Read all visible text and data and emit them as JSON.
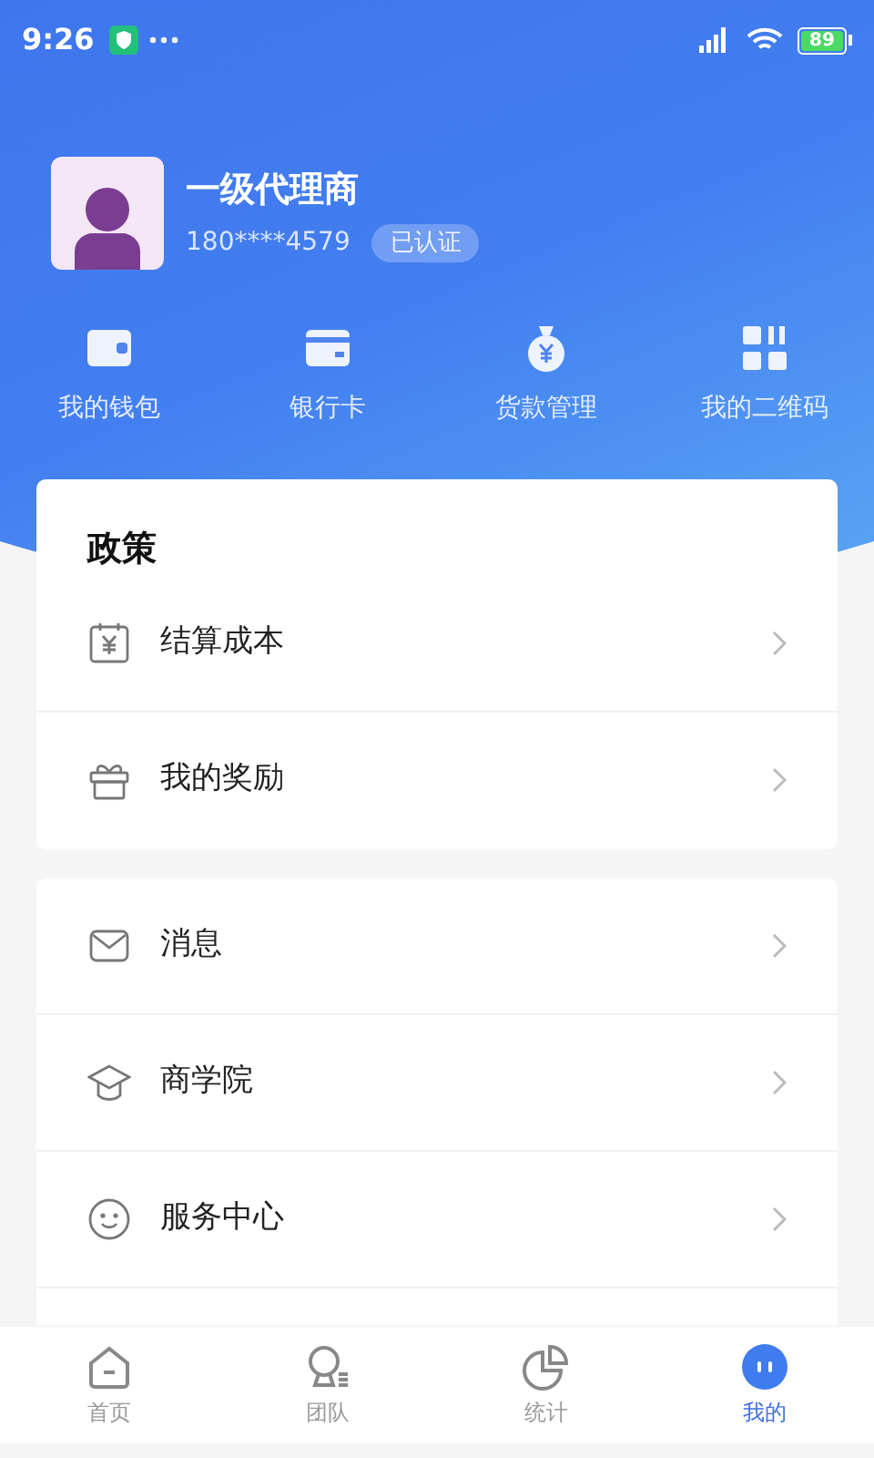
{
  "status_bar": {
    "time": "9:26",
    "battery": "89"
  },
  "profile": {
    "name": "一级代理商",
    "phone": "180****4579",
    "badge": "已认证"
  },
  "shortcuts": [
    {
      "kind": "wallet",
      "label": "我的钱包"
    },
    {
      "kind": "card",
      "label": "银行卡"
    },
    {
      "kind": "moneybag",
      "label": "货款管理"
    },
    {
      "kind": "qrcode",
      "label": "我的二维码"
    }
  ],
  "policy": {
    "title": "政策",
    "items": [
      {
        "kind": "yen",
        "label": "结算成本"
      },
      {
        "kind": "gift",
        "label": "我的奖励"
      }
    ]
  },
  "menu": [
    {
      "kind": "mail",
      "label": "消息"
    },
    {
      "kind": "cap",
      "label": "商学院"
    },
    {
      "kind": "smile",
      "label": "服务中心"
    }
  ],
  "tabs": [
    {
      "kind": "home",
      "label": "首页",
      "selected": false
    },
    {
      "kind": "team",
      "label": "团队",
      "selected": false
    },
    {
      "kind": "chart",
      "label": "统计",
      "selected": false
    },
    {
      "kind": "me",
      "label": "我的",
      "selected": true
    }
  ]
}
